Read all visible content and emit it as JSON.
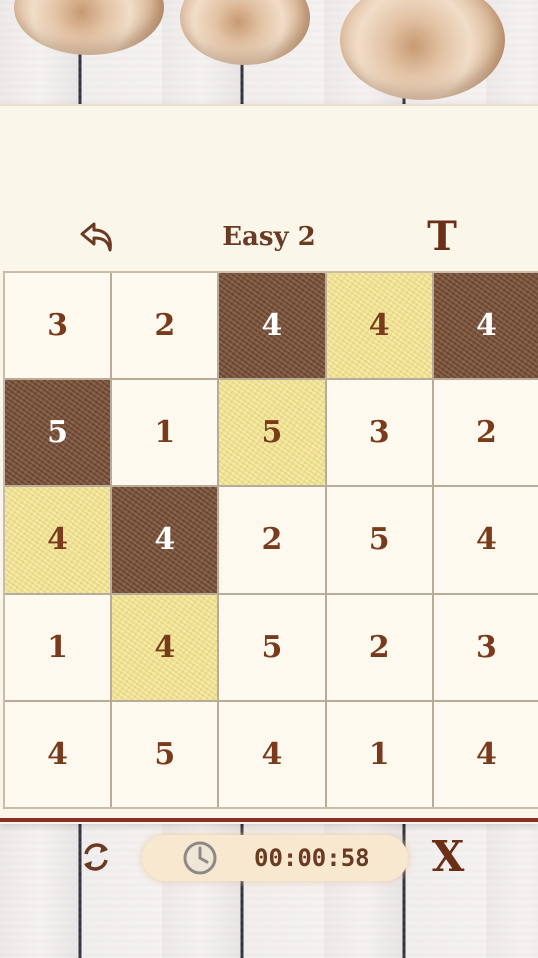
{
  "header": {
    "level_title": "Easy 2",
    "hint_label": "T"
  },
  "board": {
    "rows": [
      [
        {
          "v": "3",
          "s": "plain"
        },
        {
          "v": "2",
          "s": "plain"
        },
        {
          "v": "4",
          "s": "dark"
        },
        {
          "v": "4",
          "s": "yellow"
        },
        {
          "v": "4",
          "s": "dark"
        }
      ],
      [
        {
          "v": "5",
          "s": "dark"
        },
        {
          "v": "1",
          "s": "plain"
        },
        {
          "v": "5",
          "s": "yellow"
        },
        {
          "v": "3",
          "s": "plain"
        },
        {
          "v": "2",
          "s": "plain"
        }
      ],
      [
        {
          "v": "4",
          "s": "yellow"
        },
        {
          "v": "4",
          "s": "dark"
        },
        {
          "v": "2",
          "s": "plain"
        },
        {
          "v": "5",
          "s": "plain"
        },
        {
          "v": "4",
          "s": "plain"
        }
      ],
      [
        {
          "v": "1",
          "s": "plain"
        },
        {
          "v": "4",
          "s": "yellow"
        },
        {
          "v": "5",
          "s": "plain"
        },
        {
          "v": "2",
          "s": "plain"
        },
        {
          "v": "3",
          "s": "plain"
        }
      ],
      [
        {
          "v": "4",
          "s": "plain"
        },
        {
          "v": "5",
          "s": "plain"
        },
        {
          "v": "4",
          "s": "plain"
        },
        {
          "v": "1",
          "s": "plain"
        },
        {
          "v": "4",
          "s": "plain"
        }
      ]
    ]
  },
  "footer": {
    "timer": "00:00:58",
    "close_label": "X"
  },
  "colors": {
    "text_brown": "#7a3b1c",
    "dark_cell": "#7b5a45",
    "yellow_cell": "#efe08a",
    "paper": "#fbf6ea"
  },
  "icons": {
    "back": "back-arrow-icon",
    "restart": "restart-icon",
    "clock": "clock-icon"
  }
}
